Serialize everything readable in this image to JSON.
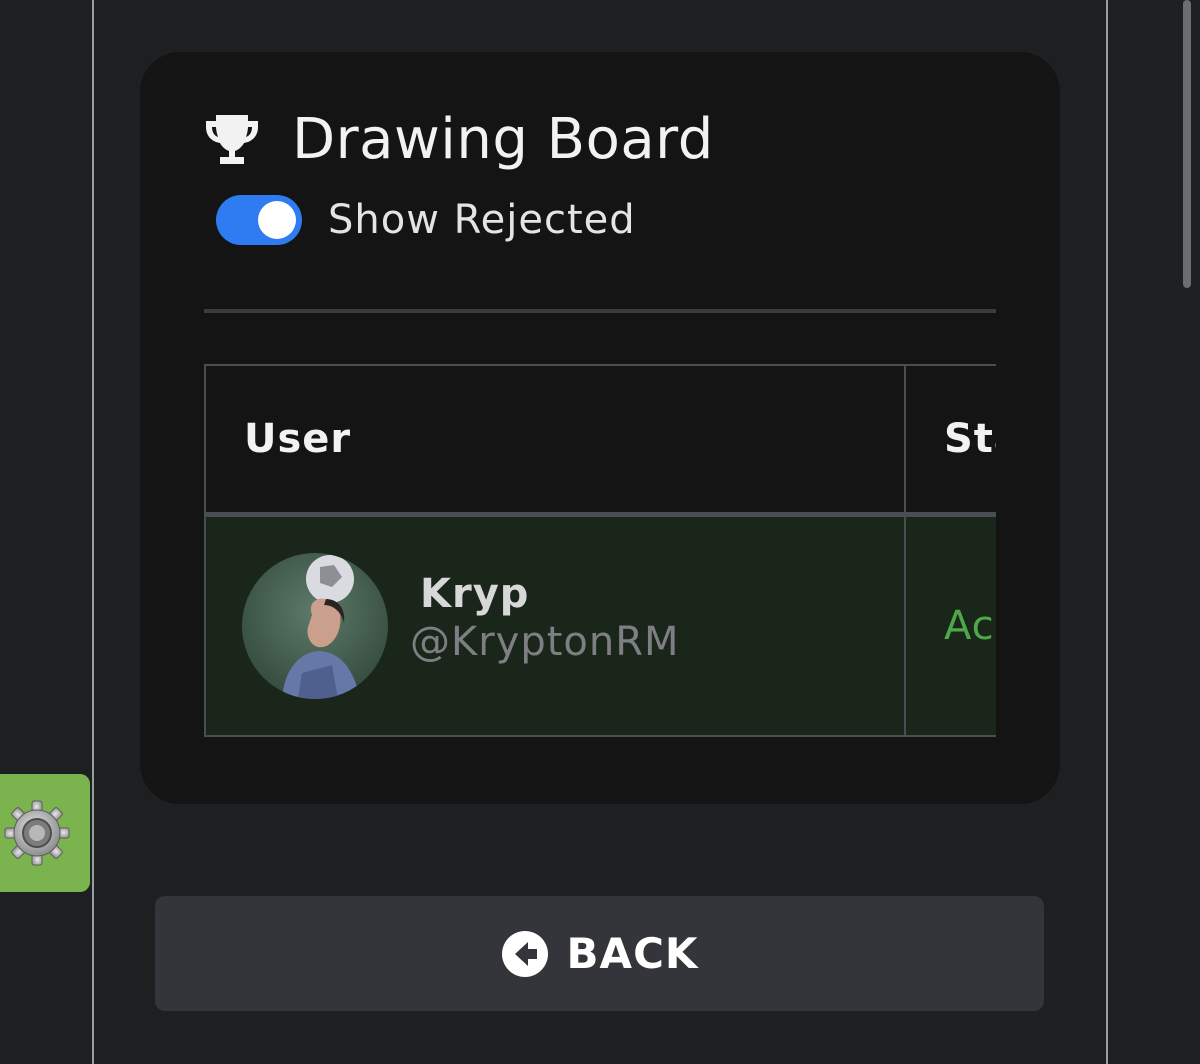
{
  "board": {
    "title": "Drawing Board",
    "icon": "trophy-icon",
    "show_rejected": {
      "label": "Show Rejected",
      "checked": true,
      "color": "#2f7bf2"
    }
  },
  "table": {
    "columns": [
      "User",
      "Stat"
    ],
    "rows": [
      {
        "display_name": "Kryp",
        "handle": "@KryptonRM",
        "status": "Acce",
        "status_color": "#4ea84a",
        "avatar": "avatar-image"
      }
    ]
  },
  "settings_tab": {
    "icon": "gear-icon",
    "color": "#7bb34f"
  },
  "back_button": {
    "label": "BACK",
    "icon": "arrow-left-circle-icon"
  }
}
